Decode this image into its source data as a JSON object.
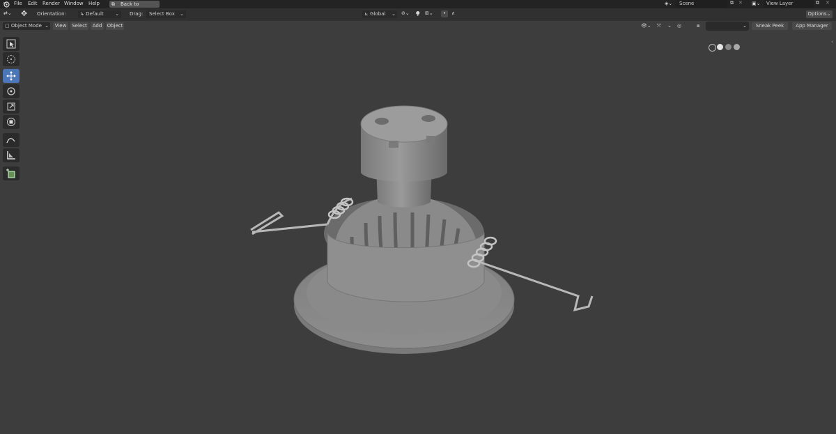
{
  "topbar": {
    "menus": [
      "File",
      "Edit",
      "Render",
      "Window",
      "Help"
    ],
    "back_button": "Back to Previous",
    "scene": {
      "label": "Scene"
    },
    "view_layer": {
      "label": "View Layer"
    }
  },
  "header": {
    "orientation_label": "Orientation:",
    "orientation_value": "Default",
    "drag_label": "Drag:",
    "drag_value": "Select Box",
    "transform_orientation": "Global",
    "options_label": "Options"
  },
  "viewport_header": {
    "mode": "Object Mode",
    "menus": [
      "View",
      "Select",
      "Add",
      "Object"
    ],
    "sneak_peek": "Sneak Peek",
    "app_manager": "App Manager"
  },
  "toolbar": {
    "tools": [
      "select-box",
      "cursor",
      "move",
      "rotate",
      "scale",
      "transform",
      "annotate",
      "measure",
      "add-cube"
    ],
    "active": "move"
  },
  "colors": {
    "active_tool": "#4b76b8",
    "viewport_bg": "#3d3d3d",
    "model": "#8c8c8c"
  }
}
